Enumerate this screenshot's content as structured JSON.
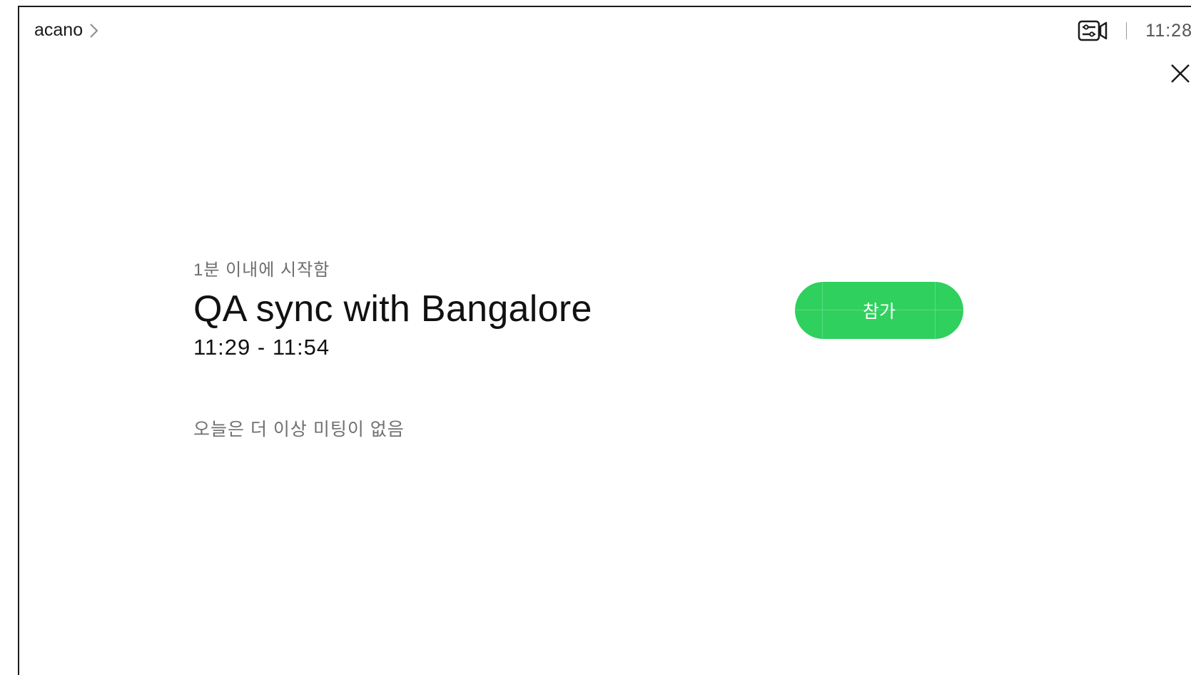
{
  "header": {
    "device_name": "acano",
    "camera_icon": "camera-settings-icon",
    "clock": "11:28"
  },
  "meeting": {
    "starts_in": "1분 이내에 시작함",
    "title": "QA sync with Bangalore",
    "time_range": "11:29 - 11:54",
    "join_label": "참가"
  },
  "footer_note": "오늘은 더 이상 미팅이 없음",
  "colors": {
    "join_button": "#2fd05d",
    "background": "#ffffff",
    "text_primary": "#111111",
    "text_secondary": "#6e6e6e"
  }
}
